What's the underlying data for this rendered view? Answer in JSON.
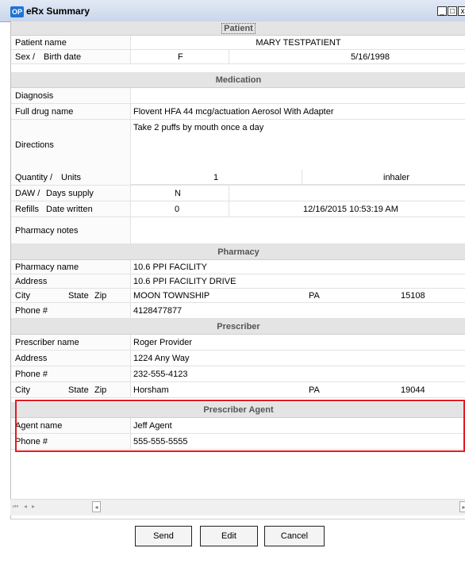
{
  "window": {
    "title": "eRx Summary",
    "icon_text": "OP"
  },
  "sections": {
    "patient": "Patient",
    "medication": "Medication",
    "pharmacy": "Pharmacy",
    "prescriber": "Prescriber",
    "prescriber_agent": "Prescriber Agent"
  },
  "patient": {
    "name_label": "Patient name",
    "name": "MARY TESTPATIENT",
    "sex_label": "Sex /",
    "birth_label": "Birth date",
    "sex": "F",
    "birth_date": "5/16/1998"
  },
  "medication": {
    "diagnosis_label": "Diagnosis",
    "diagnosis": "",
    "drug_label": "Full drug name",
    "drug": "Flovent HFA 44 mcg/actuation Aerosol With Adapter",
    "directions_label": "Directions",
    "directions": "Take 2 puffs by mouth once a day",
    "quantity_label": "Quantity /",
    "units_label": "Units",
    "quantity": "1",
    "units": "inhaler",
    "daw_label": "DAW /",
    "days_label": "Days supply",
    "daw": "N",
    "refills_label": "Refills",
    "date_written_label": "Date written",
    "refills": "0",
    "date_written": "12/16/2015 10:53:19 AM",
    "notes_label": "Pharmacy notes",
    "notes": ""
  },
  "pharmacy": {
    "name_label": "Pharmacy name",
    "name": "10.6 PPI FACILITY",
    "address_label": "Address",
    "address": "10.6 PPI FACILITY DRIVE",
    "city_label": "City",
    "state_label": "State",
    "zip_label": "Zip",
    "city": "MOON TOWNSHIP",
    "state": "PA",
    "zip": "15108",
    "phone_label": "Phone #",
    "phone": "4128477877"
  },
  "prescriber": {
    "name_label": "Prescriber name",
    "name": "Roger Provider",
    "address_label": "Address",
    "address": "1224 Any Way",
    "phone_label": "Phone #",
    "phone": "232-555-4123",
    "city_label": "City",
    "state_label": "State",
    "zip_label": "Zip",
    "city": "Horsham",
    "state": "PA",
    "zip": "19044"
  },
  "agent": {
    "name_label": "Agent name",
    "name": "Jeff Agent",
    "phone_label": "Phone #",
    "phone": "555-555-5555"
  },
  "buttons": {
    "send": "Send",
    "edit": "Edit",
    "cancel": "Cancel"
  },
  "colors": {
    "highlight": "#e31b23",
    "section_bg": "#e4e4e4"
  }
}
